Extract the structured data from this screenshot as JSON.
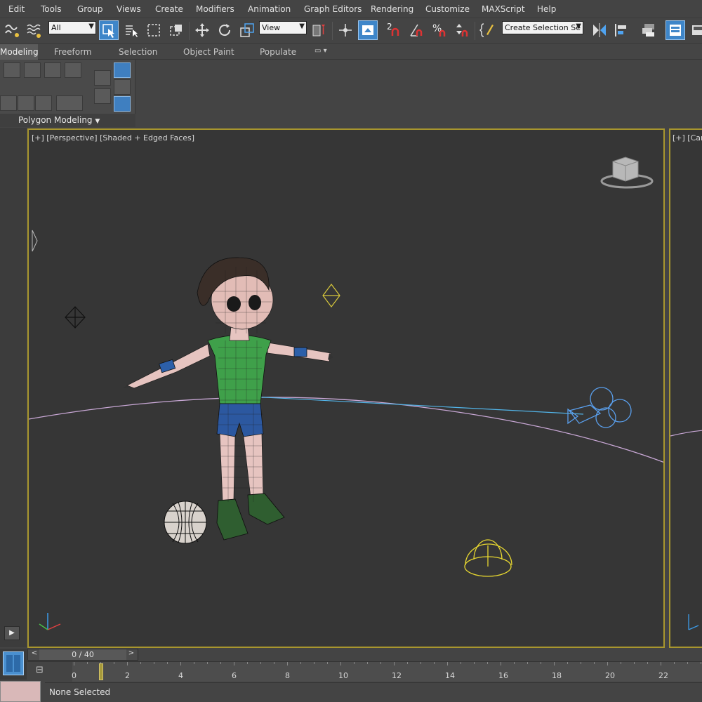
{
  "menu": [
    "Edit",
    "Tools",
    "Group",
    "Views",
    "Create",
    "Modifiers",
    "Animation",
    "Graph Editors",
    "Rendering",
    "Customize",
    "MAXScript",
    "Help"
  ],
  "toolbar": {
    "selection_filter": "All",
    "reference_coord": "View",
    "named_selection_placeholder": "Create Selection Se",
    "snap_label": "2",
    "active_color": "#3e86c9"
  },
  "ribbon": {
    "tabs": [
      "Modeling",
      "Freeform",
      "Selection",
      "Object Paint",
      "Populate"
    ],
    "active_tab": "Modeling",
    "panel_title": "Polygon Modeling"
  },
  "viewport": {
    "label": "[+] [Perspective] [Shaded + Edged Faces]",
    "border_color": "#a8962e",
    "background": "#363636"
  },
  "viewport_right": {
    "label": "[+] [Can"
  },
  "timeline": {
    "slider_text": "0 / 40",
    "prev": "<",
    "next": ">",
    "ticks": [
      "0",
      "2",
      "4",
      "6",
      "8",
      "10",
      "12",
      "14",
      "16",
      "18",
      "20",
      "22"
    ]
  },
  "status": {
    "text": "None Selected"
  }
}
